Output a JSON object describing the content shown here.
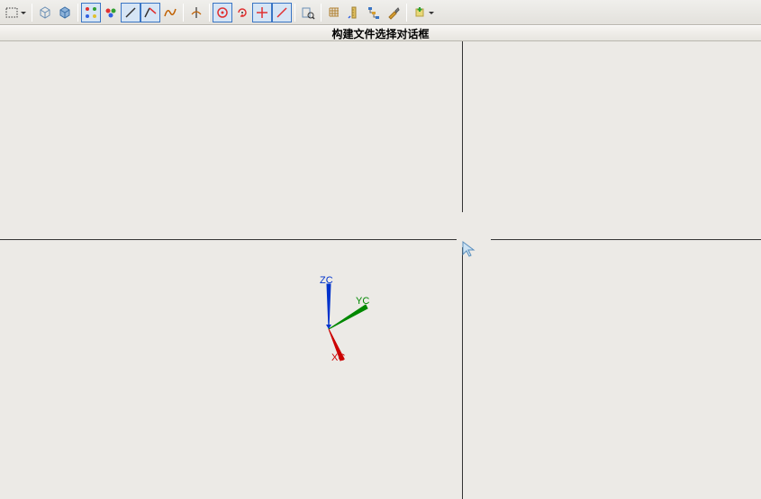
{
  "titlebar": "构建文件选择对话框",
  "triad": {
    "x_label": "XC",
    "y_label": "YC",
    "z_label": "ZC",
    "x_color": "#cc0000",
    "y_color": "#008800",
    "z_color": "#0033cc"
  },
  "toolbar": {
    "icons": [
      "rectangle-select-icon",
      "box-icon",
      "cube-icon",
      "colored-points-icon",
      "colored-cluster-icon",
      "line-icon",
      "arc-icon",
      "spline-icon",
      "intersection-icon",
      "circle-icon",
      "rotate-icon",
      "crosshair-icon",
      "diagonal-line-icon",
      "analyze-icon",
      "grid-icon",
      "measure-icon",
      "tree-icon",
      "tools-icon",
      "add-icon"
    ]
  }
}
